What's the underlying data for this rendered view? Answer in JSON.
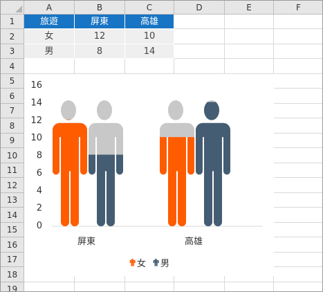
{
  "columns": [
    "A",
    "B",
    "C",
    "D",
    "E",
    "F"
  ],
  "rows": [
    "1",
    "2",
    "3",
    "4",
    "5",
    "6",
    "7",
    "8",
    "9",
    "10",
    "11",
    "12",
    "13",
    "14",
    "15",
    "16",
    "17",
    "18",
    "19"
  ],
  "table": {
    "header": [
      "旅遊",
      "屏東",
      "高雄"
    ],
    "body": [
      [
        "女",
        "12",
        "10"
      ],
      [
        "男",
        "8",
        "14"
      ]
    ]
  },
  "colors": {
    "female": "#ff5c00",
    "male": "#455d73",
    "empty": "#c8c8c8",
    "header_fill": "#1874c4"
  },
  "chart_data": {
    "type": "bar",
    "categories": [
      "屏東",
      "高雄"
    ],
    "series": [
      {
        "name": "女",
        "values": [
          12,
          10
        ]
      },
      {
        "name": "男",
        "values": [
          8,
          14
        ]
      }
    ],
    "ylim": [
      0,
      16
    ],
    "yticks": [
      "0",
      "2",
      "4",
      "6",
      "8",
      "10",
      "12",
      "14",
      "16"
    ],
    "grid": false,
    "legend_position": "bottom",
    "legend": [
      {
        "label": "女",
        "icon": "person-icon"
      },
      {
        "label": "男",
        "icon": "person-icon"
      }
    ]
  }
}
